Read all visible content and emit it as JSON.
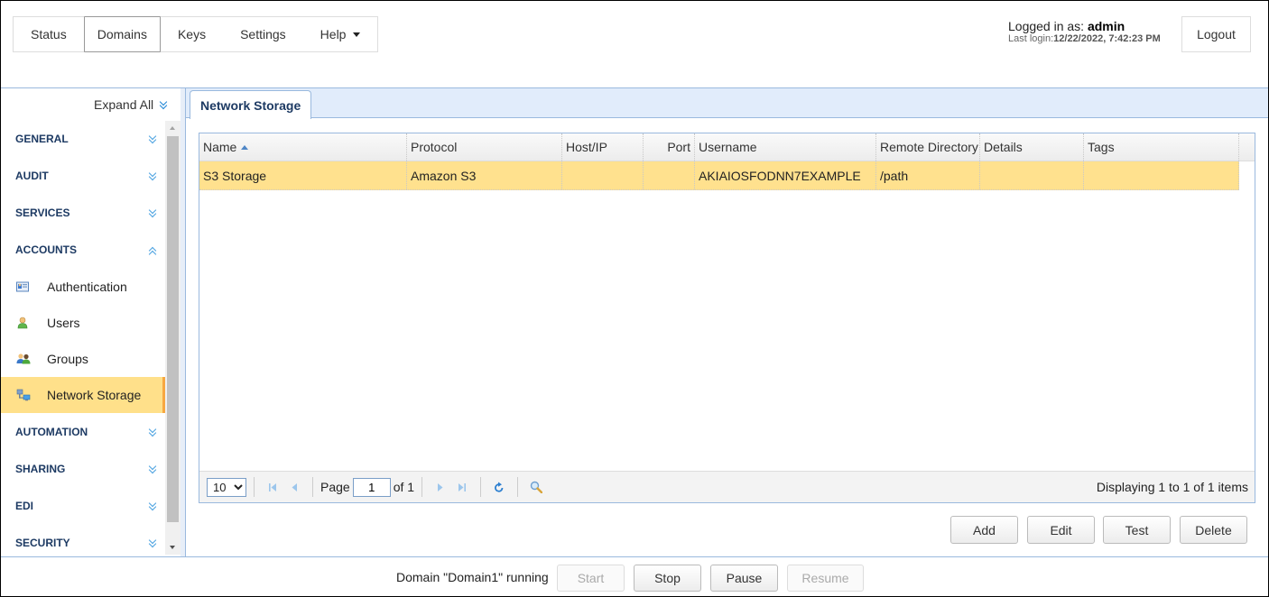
{
  "topnav": {
    "items": [
      {
        "label": "Status",
        "active": false
      },
      {
        "label": "Domains",
        "active": true
      },
      {
        "label": "Keys",
        "active": false
      },
      {
        "label": "Settings",
        "active": false
      },
      {
        "label": "Help",
        "active": false,
        "dropdown": true
      }
    ]
  },
  "user": {
    "logged_in_prefix": "Logged in as: ",
    "username": "admin",
    "last_login_prefix": "Last login:",
    "last_login": "12/22/2022, 7:42:23 PM",
    "logout_label": "Logout"
  },
  "sidebar": {
    "expand_all_label": "Expand All",
    "sections": [
      {
        "label": "GENERAL",
        "expanded": false
      },
      {
        "label": "AUDIT",
        "expanded": false
      },
      {
        "label": "SERVICES",
        "expanded": false
      },
      {
        "label": "ACCOUNTS",
        "expanded": true
      },
      {
        "label": "AUTOMATION",
        "expanded": false
      },
      {
        "label": "SHARING",
        "expanded": false
      },
      {
        "label": "EDI",
        "expanded": false
      },
      {
        "label": "SECURITY",
        "expanded": false
      }
    ],
    "account_items": [
      {
        "label": "Authentication",
        "icon": "authentication-icon",
        "selected": false
      },
      {
        "label": "Users",
        "icon": "user-icon",
        "selected": false
      },
      {
        "label": "Groups",
        "icon": "groups-icon",
        "selected": false
      },
      {
        "label": "Network Storage",
        "icon": "network-storage-icon",
        "selected": true
      }
    ]
  },
  "main": {
    "tab_label": "Network Storage",
    "grid": {
      "columns": [
        "Name",
        "Protocol",
        "Host/IP",
        "Port",
        "Username",
        "Remote Directory",
        "Details",
        "Tags"
      ],
      "sort_column": "Name",
      "sort_direction": "ascending",
      "rows": [
        {
          "Name": "S3 Storage",
          "Protocol": "Amazon S3",
          "Host/IP": "",
          "Port": "",
          "Username": "AKIAIOSFODNN7EXAMPLE",
          "Remote Directory": "/path",
          "Details": "",
          "Tags": ""
        }
      ]
    },
    "pager": {
      "page_size": "10",
      "page_label": "Page",
      "current_page": "1",
      "of_label": "of 1",
      "displaying": "Displaying 1 to 1 of 1 items"
    },
    "actions": {
      "add": "Add",
      "edit": "Edit",
      "test": "Test",
      "delete": "Delete"
    }
  },
  "footer": {
    "domain_status": "Domain \"Domain1\" running",
    "start": "Start",
    "stop": "Stop",
    "pause": "Pause",
    "resume": "Resume",
    "start_enabled": false,
    "stop_enabled": true,
    "pause_enabled": true,
    "resume_enabled": false
  },
  "colors": {
    "selected_row": "#ffe18e",
    "selected_nav_accent": "#f7a740",
    "section_heading": "#1d3a63",
    "panel_border": "#9ab9de",
    "tabbar_bg": "#e1ecfb"
  }
}
